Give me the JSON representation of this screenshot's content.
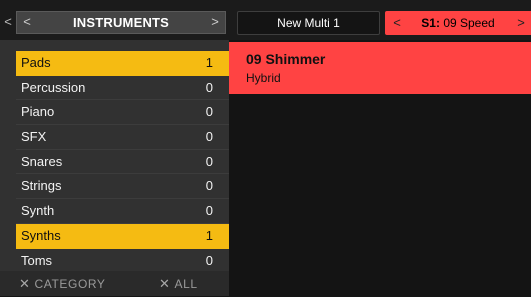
{
  "instruments": {
    "title": "INSTRUMENTS",
    "prev_arrow": "<",
    "next_arrow": ">",
    "outer_arrow": "<",
    "categories": [
      {
        "label": "Pads",
        "count": "1",
        "active": true
      },
      {
        "label": "Percussion",
        "count": "0",
        "active": false
      },
      {
        "label": "Piano",
        "count": "0",
        "active": false
      },
      {
        "label": "SFX",
        "count": "0",
        "active": false
      },
      {
        "label": "Snares",
        "count": "0",
        "active": false
      },
      {
        "label": "Strings",
        "count": "0",
        "active": false
      },
      {
        "label": "Synth",
        "count": "0",
        "active": false
      },
      {
        "label": "Synths",
        "count": "1",
        "active": true
      },
      {
        "label": "Toms",
        "count": "0",
        "active": false
      }
    ],
    "footer": {
      "clear_category_icon": "✕",
      "clear_category_label": "CATEGORY",
      "clear_all_icon": "✕",
      "clear_all_label": "ALL"
    }
  },
  "multi": {
    "name": "New Multi 1"
  },
  "slot": {
    "prev_arrow": "<",
    "next_arrow": ">",
    "slot_id": "S1:",
    "slot_name": "09 Speed"
  },
  "preset": {
    "name": "09 Shimmer",
    "type": "Hybrid"
  },
  "colors": {
    "accent_yellow": "#f5bb12",
    "accent_red": "#ff4343",
    "panel_dark": "#313131",
    "background": "#141414"
  }
}
